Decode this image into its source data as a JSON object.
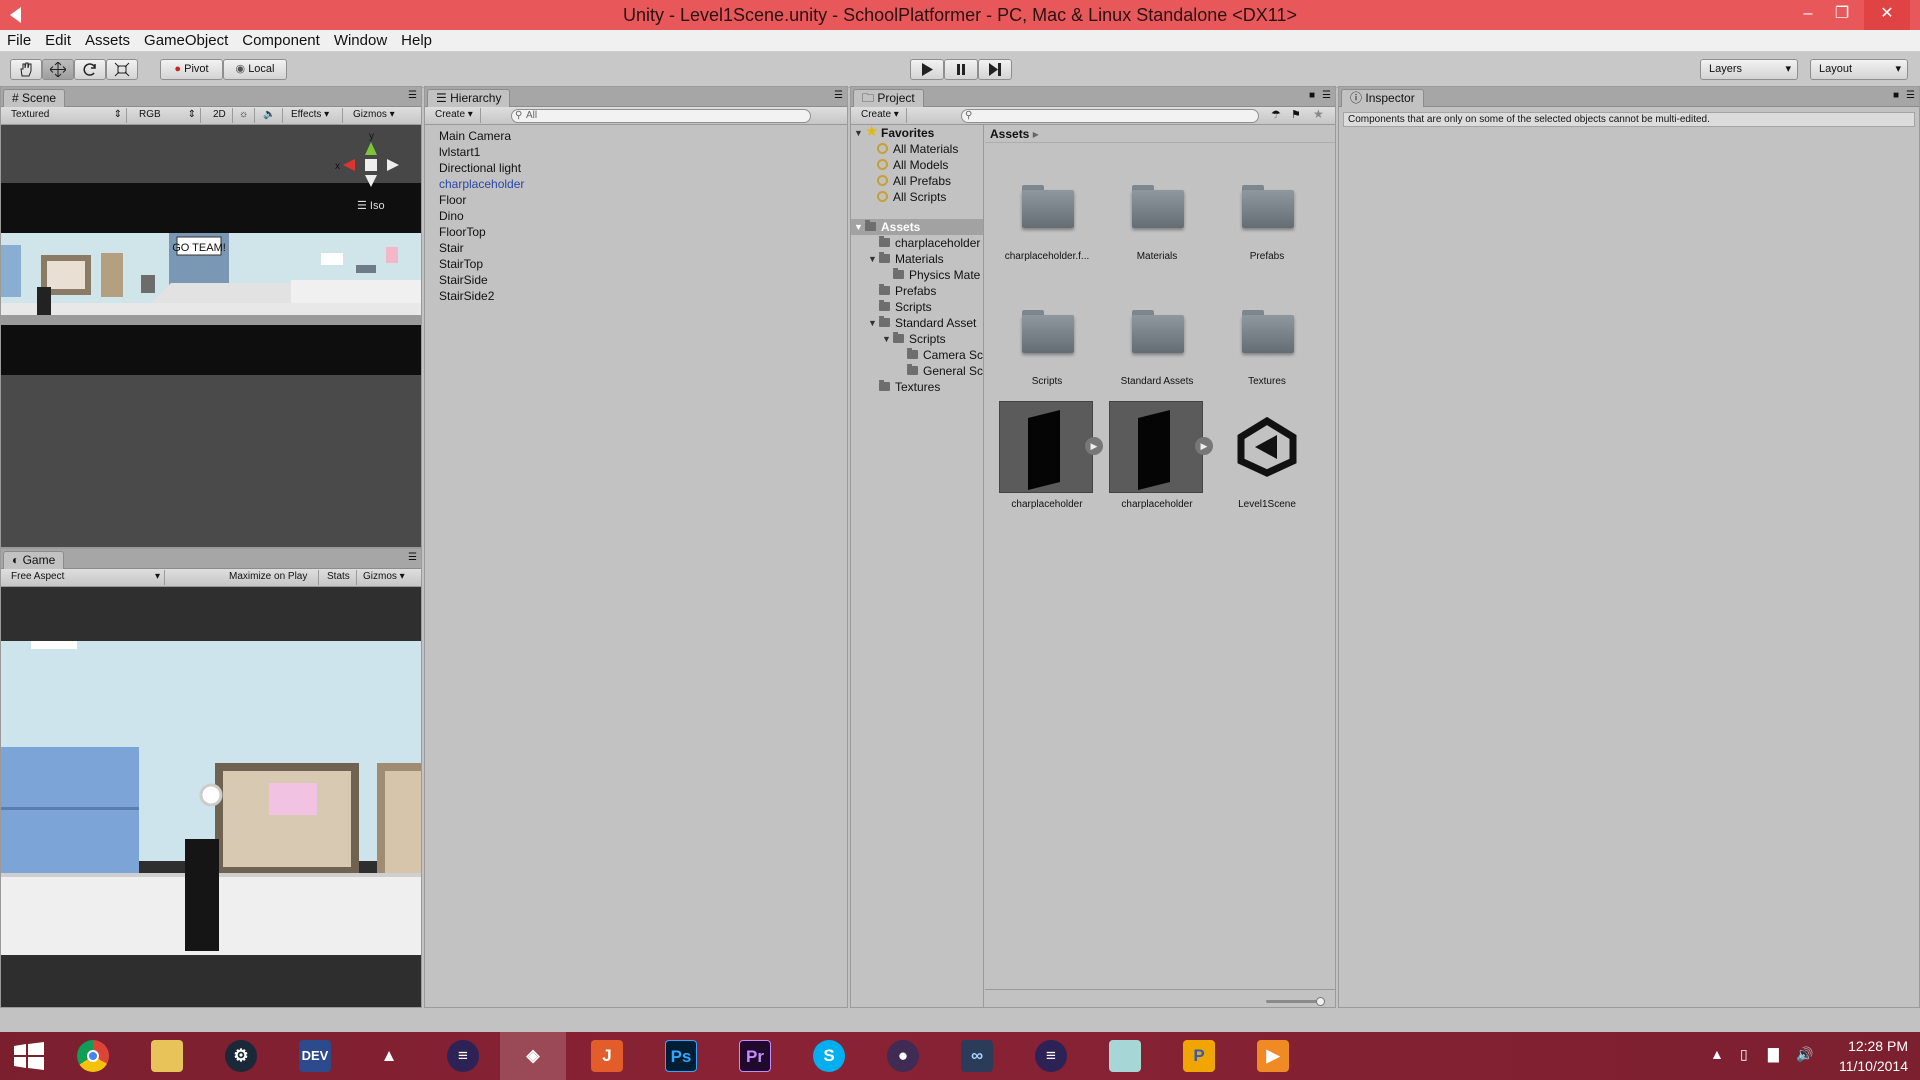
{
  "window": {
    "title": "Unity - Level1Scene.unity - SchoolPlatformer - PC, Mac & Linux Standalone <DX11>"
  },
  "menu": [
    "File",
    "Edit",
    "Assets",
    "GameObject",
    "Component",
    "Window",
    "Help"
  ],
  "toolbar": {
    "pivot": "Pivot",
    "local": "Local",
    "layers": "Layers",
    "layout": "Layout"
  },
  "scene": {
    "tab": "Scene",
    "shading": "Textured",
    "rgb": "RGB",
    "mode2d": "2D",
    "effects": "Effects",
    "gizmos": "Gizmos",
    "gizmo_y": "y",
    "gizmo_x": "x",
    "iso": "Iso",
    "sign": "GO TEAM!"
  },
  "game": {
    "tab": "Game",
    "aspect": "Free Aspect",
    "maximize": "Maximize on Play",
    "stats": "Stats",
    "gizmos": "Gizmos"
  },
  "hierarchy": {
    "tab": "Hierarchy",
    "create": "Create",
    "search": "All",
    "items": [
      "Main Camera",
      "lvlstart1",
      "Directional light",
      "charplaceholder",
      "Floor",
      "Dino",
      "FloorTop",
      "Stair",
      "StairTop",
      "StairSide",
      "StairSide2"
    ],
    "selected_index": 3
  },
  "project": {
    "tab": "Project",
    "create": "Create",
    "favorites_label": "Favorites",
    "favorites": [
      "All Materials",
      "All Models",
      "All Prefabs",
      "All Scripts"
    ],
    "assets_label": "Assets",
    "tree": [
      "charplaceholder",
      "Materials",
      "Physics Mate",
      "Prefabs",
      "Scripts",
      "Standard Asset",
      "Scripts",
      "Camera Sc",
      "General Sc",
      "Textures"
    ],
    "breadcrumb": "Assets",
    "grid": [
      "charplaceholder.f...",
      "Materials",
      "Prefabs",
      "Scripts",
      "Standard Assets",
      "Textures",
      "charplaceholder",
      "charplaceholder",
      "Level1Scene"
    ]
  },
  "inspector": {
    "tab": "Inspector",
    "message": "Components that are only on some of the selected objects cannot be multi-edited."
  },
  "taskbar": {
    "apps": [
      "windows-start",
      "chrome",
      "file-explorer",
      "steam",
      "dev-cpp",
      "inkscape",
      "eclipse",
      "unity",
      "intellij",
      "photoshop",
      "premiere",
      "skype",
      "github",
      "visual-studio",
      "eclipse",
      "notes",
      "paint",
      "media-player"
    ],
    "labels": {
      "dev": "DEV",
      "ps": "Ps",
      "pr": "Pr",
      "ij": "J"
    },
    "time": "12:28 PM",
    "date": "11/10/2014"
  },
  "colors": {
    "titlebar": "#e8585a",
    "taskbar": "#892234",
    "panel": "#c2c2c2",
    "selection": "#2a46a6"
  }
}
